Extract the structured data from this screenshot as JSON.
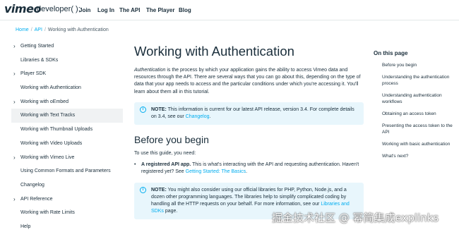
{
  "header": {
    "logo": "vimeo",
    "logo_sub": "developer( );",
    "nav": [
      "Join",
      "Log In",
      "The API",
      "The Player",
      "Blog"
    ]
  },
  "breadcrumb": [
    "Home",
    "API",
    "Working with Authentication"
  ],
  "sidebar": {
    "items": [
      {
        "label": "Getting Started",
        "chevron": true
      },
      {
        "label": "Libraries & SDKs",
        "chevron": false
      },
      {
        "label": "Player SDK",
        "chevron": true
      },
      {
        "label": "Working with Authentication",
        "chevron": false
      },
      {
        "label": "Working with oEmbed",
        "chevron": true
      },
      {
        "label": "Working with Text Tracks",
        "chevron": false,
        "active": true
      },
      {
        "label": "Working with Thumbnail Uploads",
        "chevron": false
      },
      {
        "label": "Working with Video Uploads",
        "chevron": false
      },
      {
        "label": "Working with Vimeo Live",
        "chevron": true
      },
      {
        "label": "Using Common Formats and Parameters",
        "chevron": false
      },
      {
        "label": "Changelog",
        "chevron": false
      },
      {
        "label": "API Reference",
        "chevron": true
      },
      {
        "label": "Working with Rate Limits",
        "chevron": false
      },
      {
        "label": "Help",
        "chevron": false
      }
    ]
  },
  "main": {
    "title": "Working with Authentication",
    "intro_em": "Authentication",
    "intro_rest": " is the process by which your application gains the ability to access Vimeo data and resources through the API. There are several ways that you can go about this, depending on the type of data that your app needs to access and the particular conditions under which you're accessing it. You'll learn about them all in this tutorial.",
    "note1_bold": "NOTE:",
    "note1_text": " This information is current for our latest API release, version 3.4. For complete details on 3.4, see our ",
    "note1_link": "Changelog",
    "note1_end": ".",
    "section_title": "Before you begin",
    "section_para": "To use this guide, you need:",
    "bullet_bold": "A registered API app.",
    "bullet_text": " This is what's interacting with the API and requesting authentication. Haven't registered yet? See ",
    "bullet_link": "Getting Started: The Basics",
    "bullet_end": ".",
    "note2_bold": "NOTE:",
    "note2_text": " You might also consider using our official libraries for PHP, Python, Node.js, and a dozen other programming languages. The libraries help to simplify complicated coding by handling all the HTTP requests on your behalf. For more information, see our ",
    "note2_link": "Libraries and SDKs",
    "note2_end": " page."
  },
  "toc": {
    "title": "On this page",
    "items": [
      "Before you begin",
      "Understanding the authentication process",
      "Understanding authentication workflows",
      "Obtaining an access token",
      "Presenting the access token to the API",
      "Working with basic authentication",
      "What's next?"
    ]
  },
  "watermark": "掘金技术社区 @ 幂简集成explinks",
  "colors": {
    "accent": "#00adef",
    "text": "#1a2e3b",
    "note_bg": "#e8f6fc"
  }
}
